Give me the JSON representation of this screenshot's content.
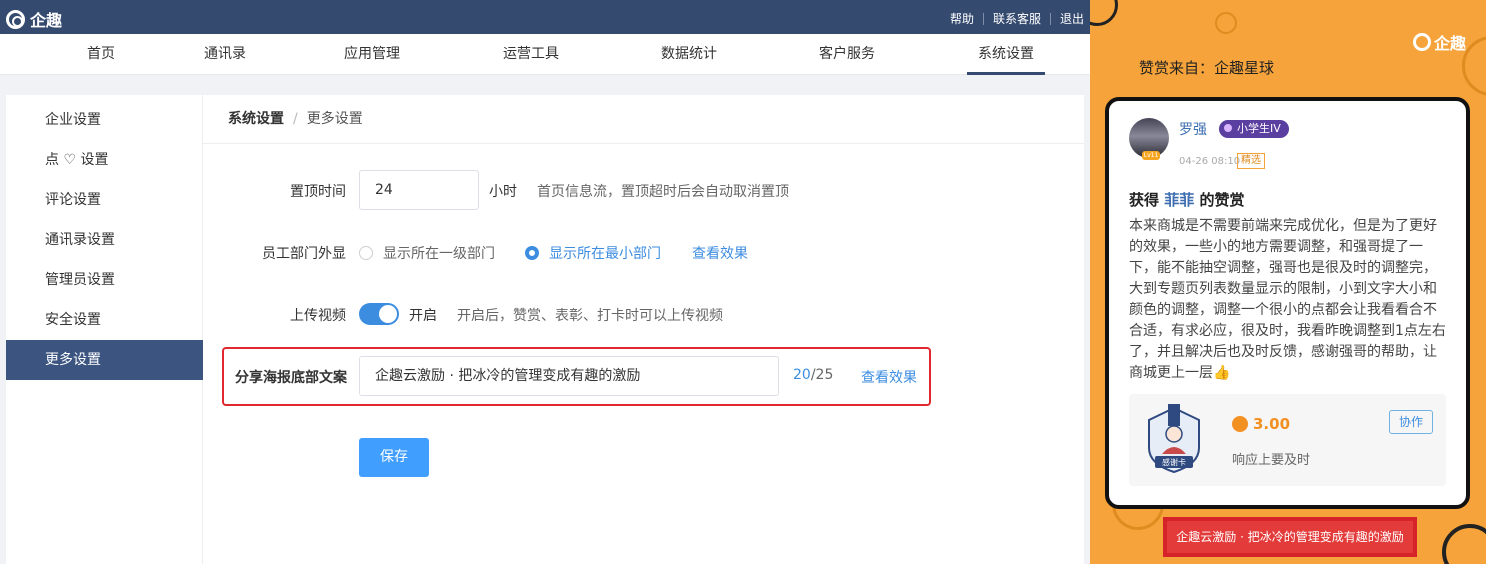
{
  "header": {
    "brand": "企趣",
    "links": [
      "帮助",
      "联系客服",
      "退出"
    ]
  },
  "nav": {
    "items": [
      "首页",
      "通讯录",
      "应用管理",
      "运营工具",
      "数据统计",
      "客户服务",
      "系统设置"
    ],
    "active": "系统设置"
  },
  "sidebar": {
    "items": [
      "企业设置",
      "点 ♡ 设置",
      "评论设置",
      "通讯录设置",
      "管理员设置",
      "安全设置",
      "更多设置"
    ],
    "active": "更多设置"
  },
  "breadcrumb": [
    "系统设置",
    "更多设置"
  ],
  "form": {
    "pin_time": {
      "label": "置顶时间",
      "value": "24",
      "unit": "小时",
      "hint": "首页信息流，置顶超时后会自动取消置顶"
    },
    "dept_display": {
      "label": "员工部门外显",
      "options": [
        "显示所在一级部门",
        "显示所在最小部门"
      ],
      "selected": "显示所在最小部门",
      "preview_link": "查看效果"
    },
    "upload_video": {
      "label": "上传视频",
      "enabled": true,
      "state_text": "开启",
      "hint": "开启后，赞赏、表彰、打卡时可以上传视频"
    },
    "share_footer": {
      "label": "分享海报底部文案",
      "value": "企趣云激励 · 把冰冷的管理变成有趣的激励",
      "count": "20",
      "limit": "/25",
      "preview_link": "查看效果"
    },
    "save_label": "保存"
  },
  "preview": {
    "logo": "企趣",
    "from": "赞赏来自：企趣星球",
    "user": {
      "name": "罗强",
      "badge": "小学生IV",
      "level": "Lv11",
      "date": "04-26 08:10",
      "tag": "精选"
    },
    "headline": {
      "prefix": "获得 ",
      "name": "菲菲",
      "suffix": " 的赞赏"
    },
    "body": "本来商城是不需要前端来完成优化，但是为了更好的效果，一些小的地方需要调整，和强哥提了一下，能不能抽空调整，强哥也是很及时的调整完，大到专题页列表数量显示的限制，小到文字大小和颜色的调整，调整一个很小的点都会让我看看合不合适，有求必应，很及时，我看昨晚调整到1点左右了，并且解决后也及时反馈，感谢强哥的帮助，让商城更上一层👍",
    "gift": {
      "card_label": "感谢卡",
      "value": "3.00",
      "desc": "响应上要及时",
      "action": "协作"
    },
    "footer_text": "企趣云激励 · 把冰冷的管理变成有趣的激励"
  }
}
